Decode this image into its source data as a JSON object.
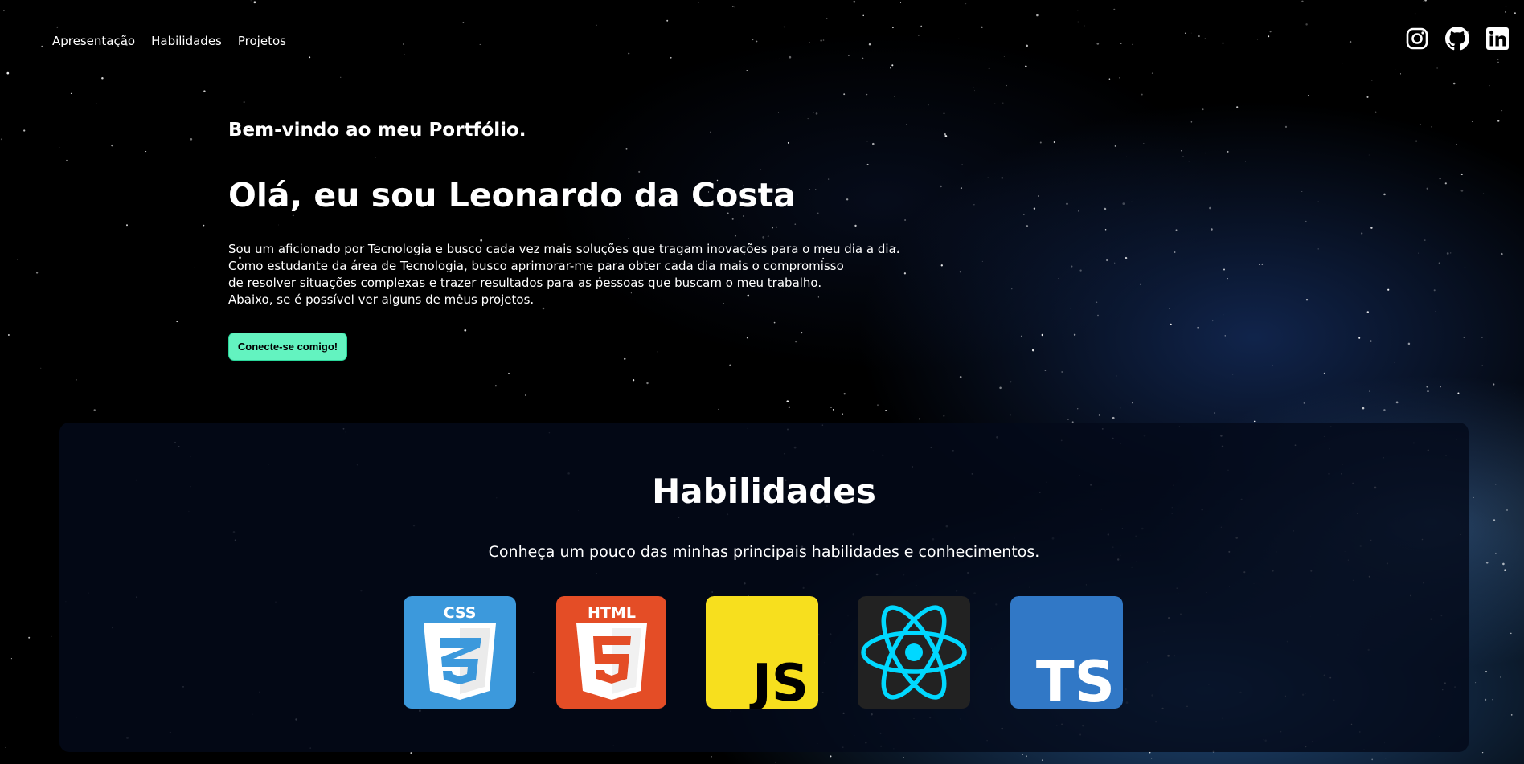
{
  "nav": {
    "links": [
      "Apresentação",
      "Habilidades",
      "Projetos"
    ]
  },
  "social": {
    "icons": [
      "instagram-icon",
      "github-icon",
      "linkedin-icon"
    ]
  },
  "hero": {
    "welcome": "Bem-vindo ao meu Portfólio.",
    "headline": "Olá, eu sou Leonardo da Costa",
    "bio": [
      "Sou um aficionado por Tecnologia e busco cada vez mais soluções que tragam inovações para o meu dia a dia.",
      "Como estudante da área de Tecnologia, busco aprimorar-me para obter cada dia mais o compromisso",
      "de resolver situações complexas e trazer resultados para as pessoas que buscam o meu trabalho.",
      "Abaixo, se é possível ver alguns de meus projetos."
    ],
    "cta_label": "Conecte-se comigo!"
  },
  "skills": {
    "title": "Habilidades",
    "subtitle": "Conheça um pouco das minhas principais habilidades e conhecimentos.",
    "logos": [
      {
        "name": "css3-logo",
        "text": "CSS",
        "color": "#3c99dc"
      },
      {
        "name": "html5-logo",
        "text": "HTML",
        "color": "#e44d26"
      },
      {
        "name": "javascript-logo",
        "text": "JS",
        "color": "#f7df1e"
      },
      {
        "name": "react-logo",
        "color": "#61dafb"
      },
      {
        "name": "typescript-logo",
        "text": "TS",
        "color": "#3178c6"
      }
    ]
  },
  "colors": {
    "accent": "#63f3c0",
    "card_bg": "#040a1a"
  }
}
